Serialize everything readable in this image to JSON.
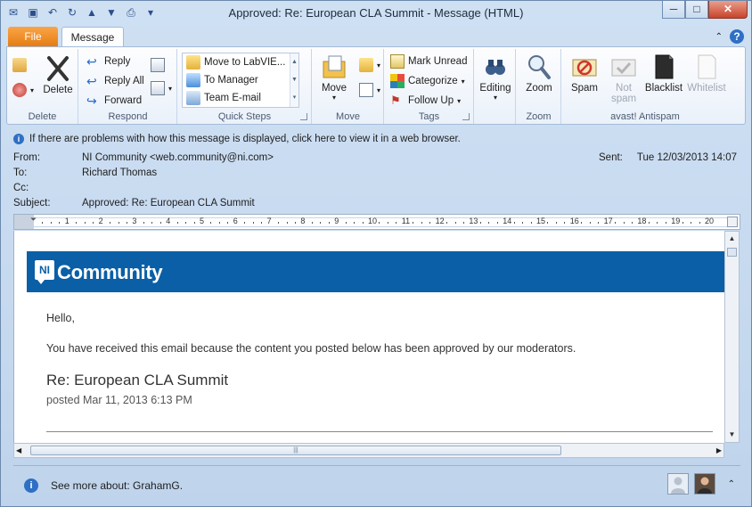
{
  "window": {
    "title": "Approved: Re: European CLA Summit  -  Message (HTML)",
    "controls": {
      "minimize": "─",
      "maximize": "□",
      "close": "✕"
    }
  },
  "tabs": {
    "file": "File",
    "message": "Message"
  },
  "ribbon": {
    "delete_group": {
      "label": "Delete",
      "delete": "Delete"
    },
    "respond_group": {
      "label": "Respond",
      "reply": "Reply",
      "reply_all": "Reply All",
      "forward": "Forward"
    },
    "quick_steps": {
      "label": "Quick Steps",
      "items": [
        "Move to LabVIE...",
        "To Manager",
        "Team E-mail"
      ]
    },
    "move_group": {
      "label": "Move",
      "move": "Move"
    },
    "tags_group": {
      "label": "Tags",
      "mark_unread": "Mark Unread",
      "categorize": "Categorize",
      "follow_up": "Follow Up"
    },
    "editing_group": {
      "editing": "Editing"
    },
    "zoom_group": {
      "label": "Zoom",
      "zoom": "Zoom"
    },
    "antispam_group": {
      "label": "avast! Antispam",
      "spam": "Spam",
      "not_spam": "Not spam",
      "blacklist": "Blacklist",
      "whitelist": "Whitelist"
    }
  },
  "infobar": {
    "text": "If there are problems with how this message is displayed, click here to view it in a web browser."
  },
  "header": {
    "from_label": "From:",
    "from": "NI Community <web.community@ni.com>",
    "to_label": "To:",
    "to": "Richard Thomas",
    "cc_label": "Cc:",
    "cc": "",
    "subject_label": "Subject:",
    "subject": "Approved: Re: European CLA Summit",
    "sent_label": "Sent:",
    "sent": "Tue 12/03/2013 14:07"
  },
  "ruler": {
    "numbers": [
      "1",
      "2",
      "3",
      "4",
      "5",
      "6",
      "7",
      "8",
      "9",
      "10",
      "11",
      "12",
      "13",
      "14",
      "15",
      "16",
      "17",
      "18",
      "19",
      "20"
    ]
  },
  "email": {
    "logo_text": "NI",
    "brand": "Community",
    "greeting": "Hello,",
    "body": "You have received this email because the content you posted below has been approved by our moderators.",
    "post_title": "Re: European CLA Summit",
    "posted": "posted Mar 11, 2013 6:13 PM"
  },
  "people_pane": {
    "text": "See more about: GrahamG."
  },
  "colors": {
    "banner": "#0a5fa6",
    "file_tab": "#e57a0f"
  }
}
